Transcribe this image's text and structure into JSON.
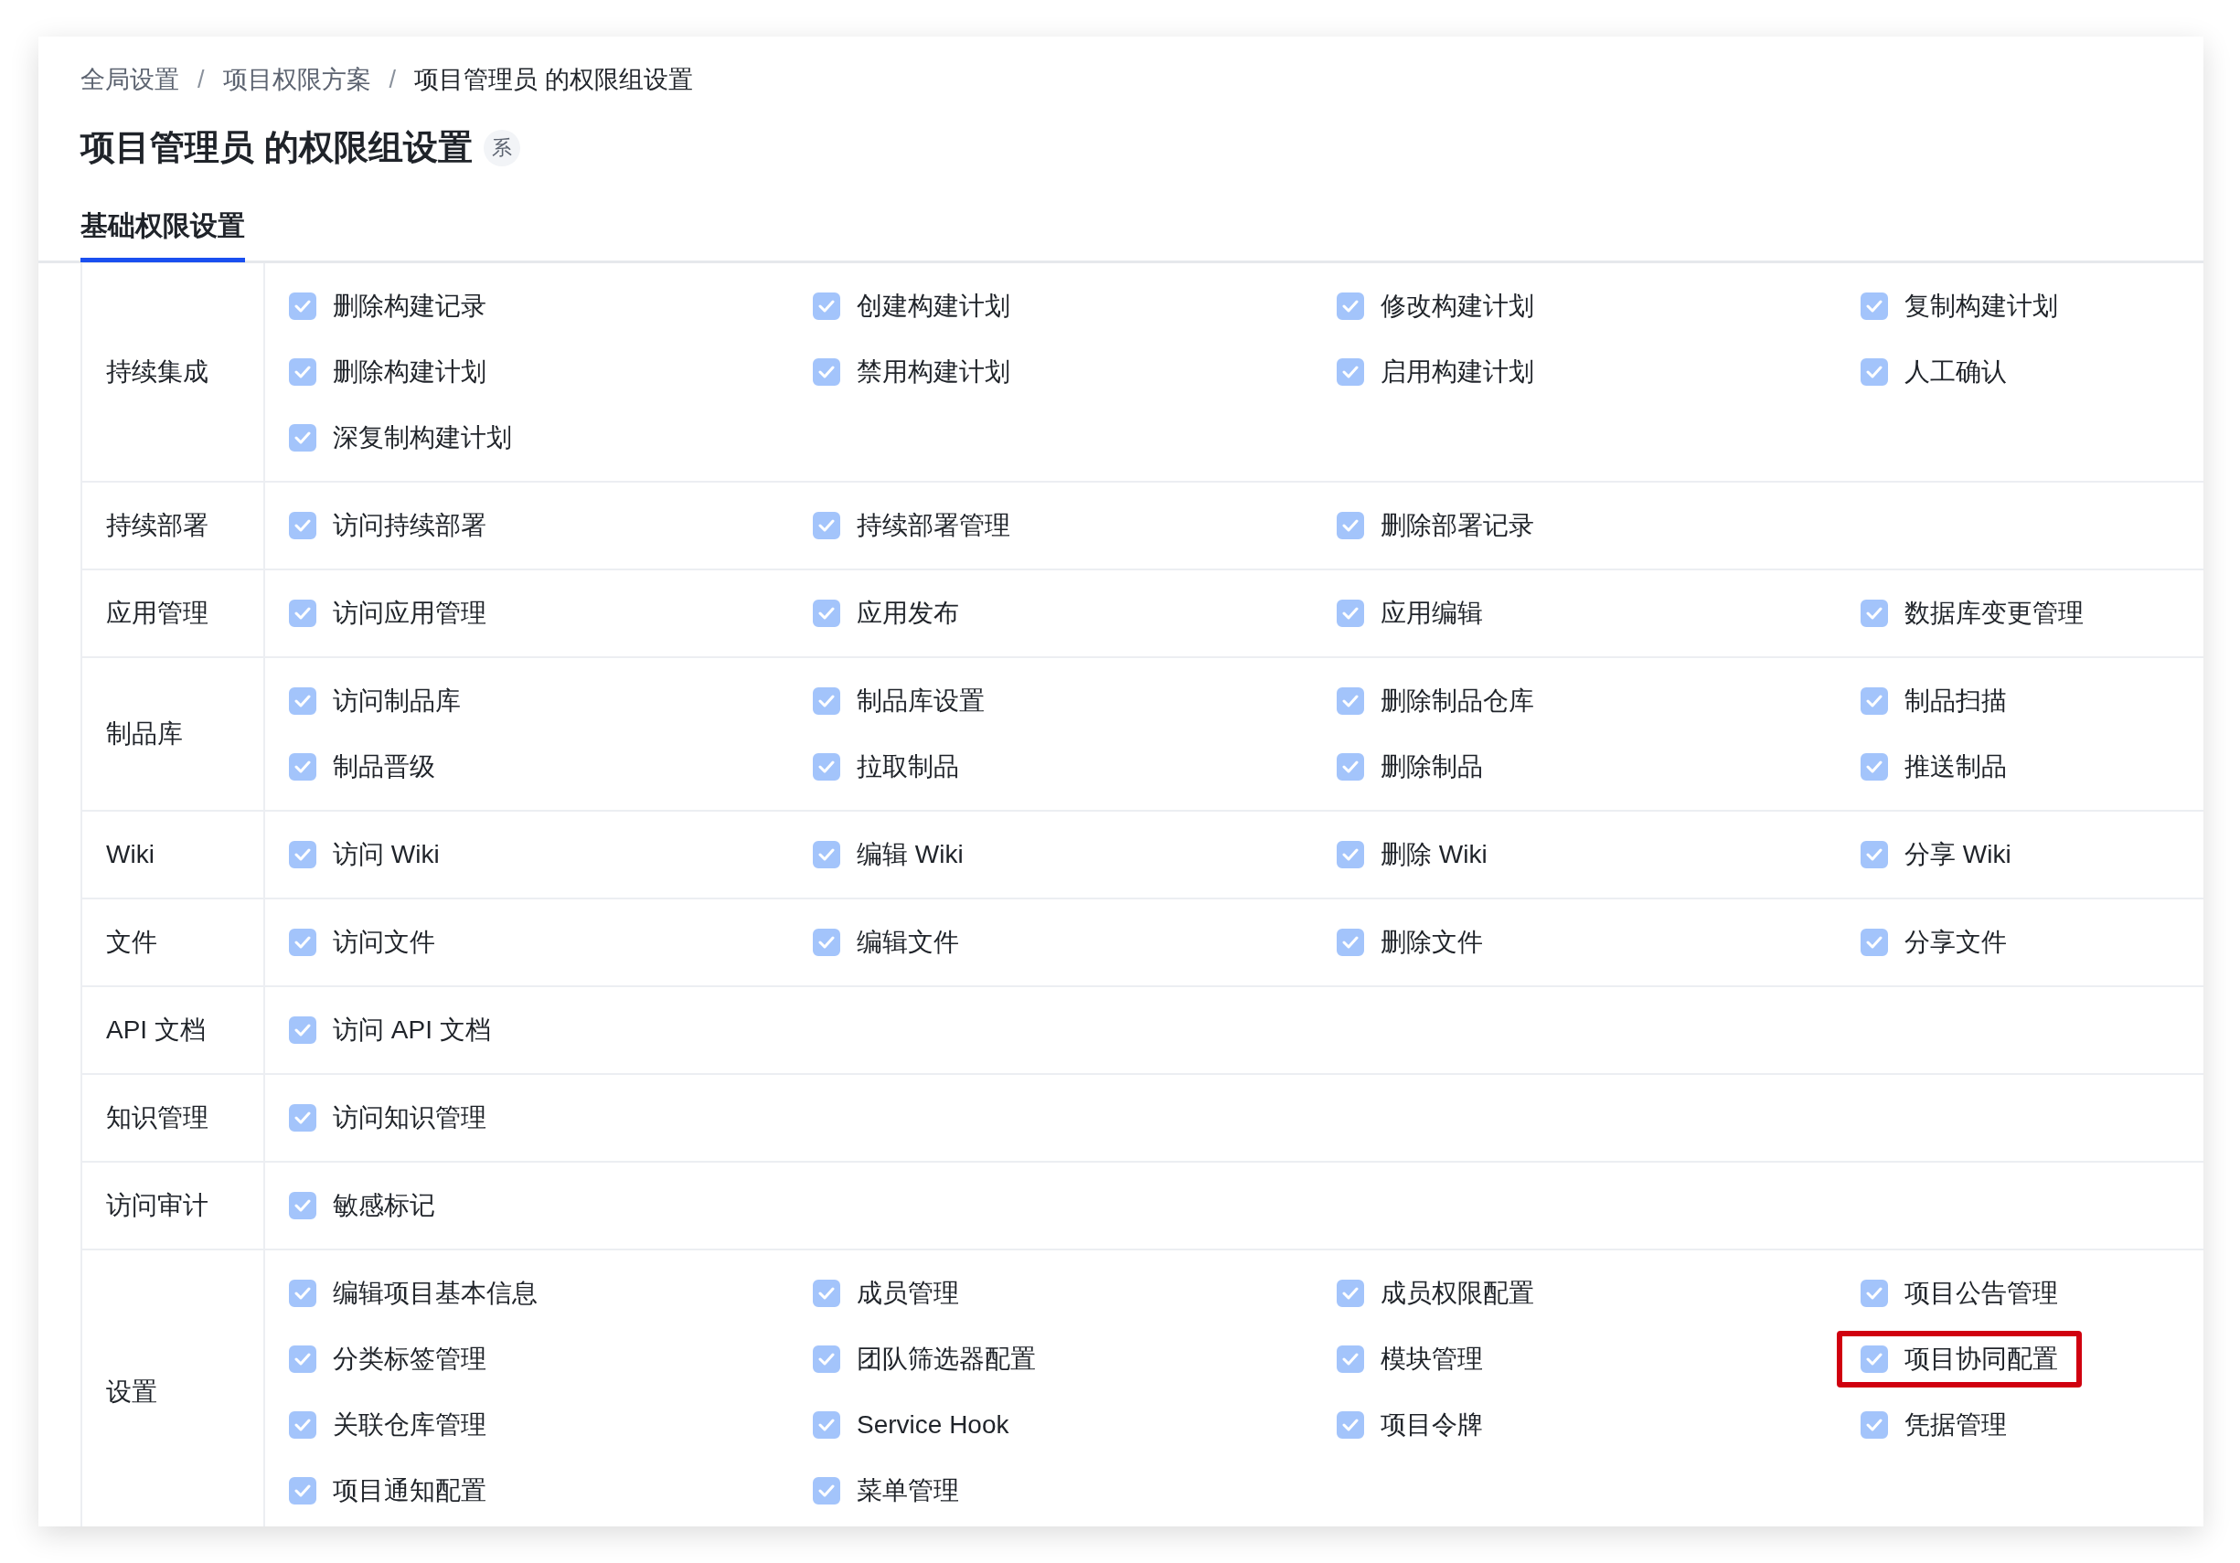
{
  "breadcrumb": [
    {
      "label": "全局设置",
      "current": false
    },
    {
      "label": "/",
      "kind": "separator"
    },
    {
      "label": "项目权限方案",
      "current": false
    },
    {
      "label": "/",
      "kind": "separator"
    },
    {
      "label": "项目管理员 的权限组设置",
      "current": true
    }
  ],
  "title": "项目管理员 的权限组设置",
  "title_badge": "系",
  "tabs": [
    {
      "label": "基础权限设置",
      "selected": true
    }
  ],
  "groups": [
    {
      "name": "持续集成",
      "items": [
        {
          "label": "删除构建记录",
          "checked": true,
          "highlighted": false
        },
        {
          "label": "创建构建计划",
          "checked": true,
          "highlighted": false
        },
        {
          "label": "修改构建计划",
          "checked": true,
          "highlighted": false
        },
        {
          "label": "复制构建计划",
          "checked": true,
          "highlighted": false
        },
        {
          "label": "删除构建计划",
          "checked": true,
          "highlighted": false
        },
        {
          "label": "禁用构建计划",
          "checked": true,
          "highlighted": false
        },
        {
          "label": "启用构建计划",
          "checked": true,
          "highlighted": false
        },
        {
          "label": "人工确认",
          "checked": true,
          "highlighted": false
        },
        {
          "label": "深复制构建计划",
          "checked": true,
          "highlighted": false
        }
      ]
    },
    {
      "name": "持续部署",
      "items": [
        {
          "label": "访问持续部署",
          "checked": true,
          "highlighted": false
        },
        {
          "label": "持续部署管理",
          "checked": true,
          "highlighted": false
        },
        {
          "label": "删除部署记录",
          "checked": true,
          "highlighted": false
        }
      ]
    },
    {
      "name": "应用管理",
      "items": [
        {
          "label": "访问应用管理",
          "checked": true,
          "highlighted": false
        },
        {
          "label": "应用发布",
          "checked": true,
          "highlighted": false
        },
        {
          "label": "应用编辑",
          "checked": true,
          "highlighted": false
        },
        {
          "label": "数据库变更管理",
          "checked": true,
          "highlighted": false
        }
      ]
    },
    {
      "name": "制品库",
      "items": [
        {
          "label": "访问制品库",
          "checked": true,
          "highlighted": false
        },
        {
          "label": "制品库设置",
          "checked": true,
          "highlighted": false
        },
        {
          "label": "删除制品仓库",
          "checked": true,
          "highlighted": false
        },
        {
          "label": "制品扫描",
          "checked": true,
          "highlighted": false
        },
        {
          "label": "制品晋级",
          "checked": true,
          "highlighted": false
        },
        {
          "label": "拉取制品",
          "checked": true,
          "highlighted": false
        },
        {
          "label": "删除制品",
          "checked": true,
          "highlighted": false
        },
        {
          "label": "推送制品",
          "checked": true,
          "highlighted": false
        }
      ]
    },
    {
      "name": "Wiki",
      "items": [
        {
          "label": "访问 Wiki",
          "checked": true,
          "highlighted": false
        },
        {
          "label": "编辑 Wiki",
          "checked": true,
          "highlighted": false
        },
        {
          "label": "删除 Wiki",
          "checked": true,
          "highlighted": false
        },
        {
          "label": "分享 Wiki",
          "checked": true,
          "highlighted": false
        }
      ]
    },
    {
      "name": "文件",
      "items": [
        {
          "label": "访问文件",
          "checked": true,
          "highlighted": false
        },
        {
          "label": "编辑文件",
          "checked": true,
          "highlighted": false
        },
        {
          "label": "删除文件",
          "checked": true,
          "highlighted": false
        },
        {
          "label": "分享文件",
          "checked": true,
          "highlighted": false
        }
      ]
    },
    {
      "name": "API 文档",
      "items": [
        {
          "label": "访问 API 文档",
          "checked": true,
          "highlighted": false
        }
      ]
    },
    {
      "name": "知识管理",
      "items": [
        {
          "label": "访问知识管理",
          "checked": true,
          "highlighted": false
        }
      ]
    },
    {
      "name": "访问审计",
      "items": [
        {
          "label": "敏感标记",
          "checked": true,
          "highlighted": false
        }
      ]
    },
    {
      "name": "设置",
      "items": [
        {
          "label": "编辑项目基本信息",
          "checked": true,
          "highlighted": false
        },
        {
          "label": "成员管理",
          "checked": true,
          "highlighted": false
        },
        {
          "label": "成员权限配置",
          "checked": true,
          "highlighted": false
        },
        {
          "label": "项目公告管理",
          "checked": true,
          "highlighted": false
        },
        {
          "label": "分类标签管理",
          "checked": true,
          "highlighted": false
        },
        {
          "label": "团队筛选器配置",
          "checked": true,
          "highlighted": false
        },
        {
          "label": "模块管理",
          "checked": true,
          "highlighted": false
        },
        {
          "label": "项目协同配置",
          "checked": true,
          "highlighted": true
        },
        {
          "label": "关联仓库管理",
          "checked": true,
          "highlighted": false
        },
        {
          "label": "Service Hook",
          "checked": true,
          "highlighted": false
        },
        {
          "label": "项目令牌",
          "checked": true,
          "highlighted": false
        },
        {
          "label": "凭据管理",
          "checked": true,
          "highlighted": false
        },
        {
          "label": "项目通知配置",
          "checked": true,
          "highlighted": false
        },
        {
          "label": "菜单管理",
          "checked": true,
          "highlighted": false
        }
      ]
    }
  ]
}
